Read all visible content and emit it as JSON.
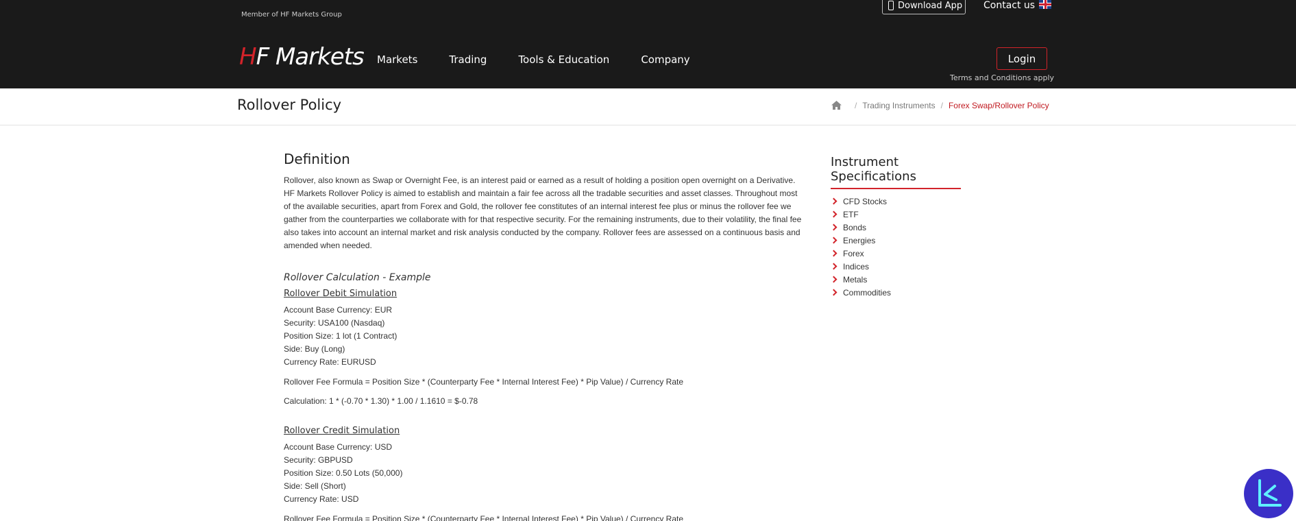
{
  "header": {
    "member_text": "Member of HF Markets Group",
    "download_label": "Download App",
    "contact_label": "Contact us",
    "logo_h": "H",
    "logo_rest": "F Markets",
    "nav": [
      "Markets",
      "Trading",
      "Tools & Education",
      "Company"
    ],
    "login_label": "Login",
    "terms_text": "Terms and Conditions apply"
  },
  "titlebar": {
    "title": "Rollover Policy",
    "breadcrumb": [
      "Trading Instruments",
      "Forex Swap/Rollover Policy"
    ],
    "separator": "/"
  },
  "main": {
    "definition_title": "Definition",
    "definition_text": "Rollover, also known as Swap or Overnight Fee, is an interest paid or earned as a result of holding a position open overnight on a Derivative. HF Markets Rollover Policy is aimed to establish and maintain a fair fee across all the tradable securities and asset classes. Throughout most of the available securities, apart from Forex and Gold, the rollover fee constitutes of an internal interest fee plus or minus the rollover fee we gather from the counterparties we collaborate with for that respective security. For the remaining instruments, due to their volatility, the final fee also takes into account an internal market and risk analysis conducted by the company. Rollover fees are assessed on a continuous basis and amended when needed.",
    "example_title": "Rollover Calculation - Example",
    "debit": {
      "title": "Rollover Debit Simulation",
      "lines": [
        "Account Base Currency: EUR",
        "Security: USA100 (Nasdaq)",
        "Position Size: 1 lot (1 Contract)",
        "Side: Buy (Long)",
        "Currency Rate: EURUSD"
      ],
      "formula": "Rollover Fee Formula = Position Size * (Counterparty Fee * Internal Interest Fee) * Pip Value) / Currency Rate",
      "calculation": "Calculation: 1 * (-0.70 * 1.30) * 1.00 / 1.1610 = $-0.78"
    },
    "credit": {
      "title": "Rollover Credit Simulation",
      "lines": [
        "Account Base Currency: USD",
        "Security: GBPUSD",
        "Position Size: 0.50 Lots (50,000)",
        "Side: Sell (Short)",
        "Currency Rate: USD"
      ],
      "formula": "Rollover Fee Formula = Position Size * (Counterparty Fee * Internal Interest Fee) * Pip Value) / Currency Rate"
    }
  },
  "sidebar": {
    "title": "Instrument Specifications",
    "items": [
      "CFD Stocks",
      "ETF",
      "Bonds",
      "Energies",
      "Forex",
      "Indices",
      "Metals",
      "Commodities"
    ]
  },
  "colors": {
    "header_bg": "#1a1a1a",
    "accent_red": "#d2232a",
    "widget_purple": "#3a2fc7"
  }
}
